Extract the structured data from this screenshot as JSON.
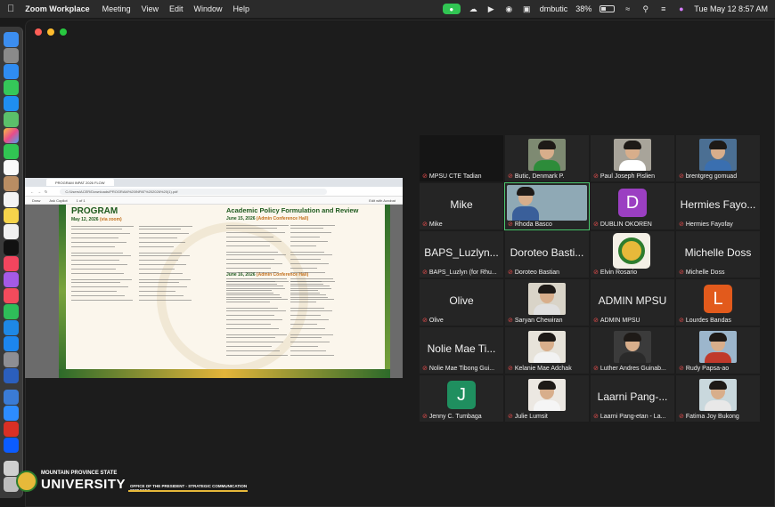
{
  "menubar": {
    "app_name": "Zoom Workplace",
    "menus": [
      "Meeting",
      "View",
      "Edit",
      "Window",
      "Help"
    ],
    "user": "dmbutic",
    "battery": "38%",
    "datetime": "Tue May 12  8:57 AM"
  },
  "share": {
    "tab_title": "PROGRAM INPAT 2026 FLOW",
    "url": "C:/Users/ACER/Downloads/PROGRAM%20INPAT%202026%20(1).pdf",
    "toolbar_left": "Draw",
    "toolbar_mid": "Ask Copilot",
    "page_counter": "1 of 1",
    "toolbar_right": "Edit with Acrobat",
    "doc": {
      "heading_left": "PROGRAM",
      "heading_right": "Academic Policy Formulation and Review",
      "date1_main": "May 12, 2026",
      "date1_note": "(via zoom)",
      "date2_main": "June 15, 2026",
      "date2_note": "(Admin Conference Hall)",
      "date3_main": "June 16, 2026",
      "date3_note": "(Admin Conference Hall)"
    }
  },
  "participants": [
    {
      "big": "",
      "label": "MPSU CTE Tadian",
      "type": "dark"
    },
    {
      "big": "",
      "label": "Butic, Denmark P.",
      "type": "photo",
      "bg": "#7e8a72",
      "shirt": "#2d8c3a"
    },
    {
      "big": "",
      "label": "Paul Joseph Pislien",
      "type": "photo",
      "bg": "#a8a49a",
      "shirt": "#ffffff"
    },
    {
      "big": "",
      "label": "brentgreg gomuad",
      "type": "photo",
      "bg": "#4b6f93",
      "shirt": "#3a6fb0"
    },
    {
      "big": "Mike",
      "label": "Mike",
      "type": "name"
    },
    {
      "big": "",
      "label": "Rhoda Basco",
      "type": "photo",
      "bg": "#8fa9b5",
      "shirt": "#3a5f9a",
      "active": true
    },
    {
      "big": "",
      "label": "DUBLIN OKOREN",
      "type": "avatar",
      "letter": "D",
      "color": "#9b3fc2"
    },
    {
      "big": "Hermies Fayo...",
      "label": "Hermies Fayofay",
      "type": "name"
    },
    {
      "big": "BAPS_Luzlyn...",
      "label": "BAPS_Luzlyn (for Rhu...",
      "type": "name"
    },
    {
      "big": "Doroteo Basti...",
      "label": "Doroteo Bastian",
      "type": "name"
    },
    {
      "big": "",
      "label": "Elvin Rosario",
      "type": "seal"
    },
    {
      "big": "Michelle Doss",
      "label": "Michelle Doss",
      "type": "name"
    },
    {
      "big": "Olive",
      "label": "Olive",
      "type": "name"
    },
    {
      "big": "",
      "label": "Saryan Chewiran",
      "type": "photo",
      "bg": "#d9d4c8",
      "shirt": "#e0e0e0"
    },
    {
      "big": "ADMIN MPSU",
      "label": "ADMIN MPSU",
      "type": "name"
    },
    {
      "big": "",
      "label": "Lourdes Bandas",
      "type": "avatar",
      "letter": "L",
      "color": "#e25a1c"
    },
    {
      "big": "Nolie Mae Ti...",
      "label": "Nolie Mae Tibong Gui...",
      "type": "name"
    },
    {
      "big": "",
      "label": "Kelanie Mae Adchak",
      "type": "photo",
      "bg": "#e7e3da",
      "shirt": "#f2f2f2"
    },
    {
      "big": "",
      "label": "Luther Andres Guinab...",
      "type": "photo",
      "bg": "#3b3b3b",
      "shirt": "#2a2a2a"
    },
    {
      "big": "",
      "label": "Rudy Papsa-ao",
      "type": "photo",
      "bg": "#9cb6cc",
      "shirt": "#c0392b"
    },
    {
      "big": "",
      "label": "Jenny C. Tumbaga",
      "type": "avatar",
      "letter": "J",
      "color": "#1f8f5f"
    },
    {
      "big": "",
      "label": "Julie Lumsit",
      "type": "photo",
      "bg": "#ece8e2",
      "shirt": "#f5f5f5"
    },
    {
      "big": "Laarni Pang-...",
      "label": "Laarni Pang-etan - La...",
      "type": "name"
    },
    {
      "big": "",
      "label": "Fatima Joy Bukong",
      "type": "photo",
      "bg": "#c9d8dd",
      "shirt": "#e8e8e8"
    }
  ],
  "watermark": {
    "line1": "MOUNTAIN PROVINCE STATE",
    "line2": "UNIVERSITY",
    "line3": "OFFICE OF THE PRESIDENT - STRATEGIC COMMUNICATION SERVICES"
  }
}
